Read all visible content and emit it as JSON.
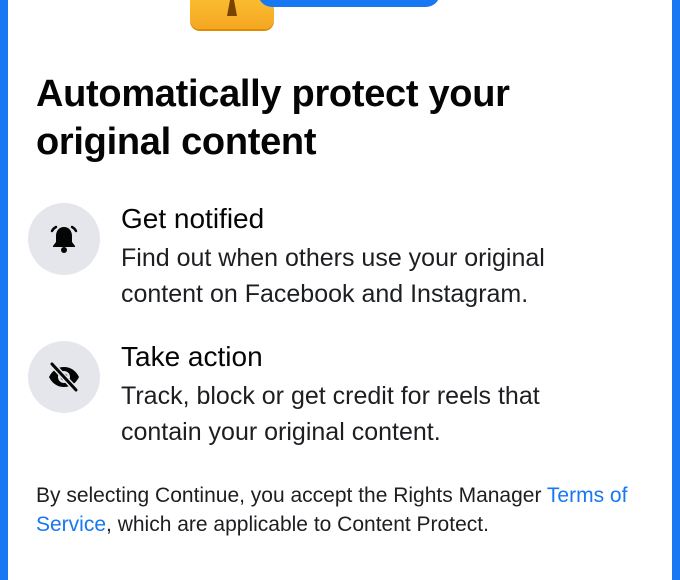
{
  "title": "Automatically protect your original content",
  "features": [
    {
      "heading": "Get notified",
      "description": "Find out when others use your original content on Facebook and Instagram.",
      "icon": "bell-ringing-icon"
    },
    {
      "heading": "Take action",
      "description": "Track, block or get credit for reels that contain your original content.",
      "icon": "eye-slash-icon"
    }
  ],
  "footer": {
    "prefix": "By selecting Continue, you accept the Rights Manager ",
    "link_label": "Terms of Service",
    "suffix": ", which are applicable to Content Protect."
  },
  "colors": {
    "accent": "#1877f2",
    "text": "#050505",
    "icon_bg": "#e4e6eb"
  }
}
